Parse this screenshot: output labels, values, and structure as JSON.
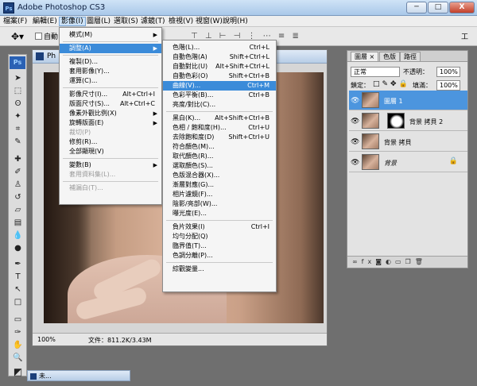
{
  "app": {
    "title": "Adobe Photoshop CS3",
    "icon": "Ps",
    "window_controls": {
      "minimize": "─",
      "maximize": "□",
      "close": "X"
    }
  },
  "menubar": [
    "檔案(F)",
    "編輯(E)",
    "影像(I)",
    "圖層(L)",
    "選取(S)",
    "濾鏡(T)",
    "檢視(V)",
    "視窗(W)",
    "說明(H)"
  ],
  "options_bar": {
    "auto_select_label": "自動",
    "workspace_label": "工"
  },
  "image_menu": {
    "items": [
      {
        "label": "模式(M)",
        "submenu": true
      },
      {
        "sep": true
      },
      {
        "label": "調整(A)",
        "submenu": true,
        "highlighted": true
      },
      {
        "sep": true
      },
      {
        "label": "複製(D)..."
      },
      {
        "label": "套用影像(Y)..."
      },
      {
        "label": "運算(C)..."
      },
      {
        "sep": true
      },
      {
        "label": "影像尺寸(I)...",
        "shortcut": "Alt+Ctrl+I"
      },
      {
        "label": "版面尺寸(S)...",
        "shortcut": "Alt+Ctrl+C"
      },
      {
        "label": "像素外觀比例(X)",
        "submenu": true
      },
      {
        "label": "旋轉版面(E)",
        "submenu": true
      },
      {
        "label": "裁切(P)",
        "disabled": true
      },
      {
        "label": "修剪(R)..."
      },
      {
        "label": "全部顯現(V)"
      },
      {
        "sep": true
      },
      {
        "label": "變數(B)",
        "submenu": true
      },
      {
        "label": "套用資料集(L)...",
        "disabled": true
      },
      {
        "sep": true
      },
      {
        "label": "補漏白(T)...",
        "disabled": true
      }
    ]
  },
  "adjust_menu": {
    "items": [
      {
        "label": "色階(L)...",
        "shortcut": "Ctrl+L"
      },
      {
        "label": "自動色階(A)",
        "shortcut": "Shift+Ctrl+L"
      },
      {
        "label": "自動對比(U)",
        "shortcut": "Alt+Shift+Ctrl+L"
      },
      {
        "label": "自動色彩(O)",
        "shortcut": "Shift+Ctrl+B"
      },
      {
        "label": "曲線(V)...",
        "shortcut": "Ctrl+M",
        "highlighted": true
      },
      {
        "label": "色彩平衡(B)...",
        "shortcut": "Ctrl+B"
      },
      {
        "label": "亮度/對比(C)..."
      },
      {
        "sep": true
      },
      {
        "label": "黑白(K)...",
        "shortcut": "Alt+Shift+Ctrl+B"
      },
      {
        "label": "色相 / 飽和度(H)...",
        "shortcut": "Ctrl+U"
      },
      {
        "label": "去除飽和度(D)",
        "shortcut": "Shift+Ctrl+U"
      },
      {
        "label": "符合顏色(M)..."
      },
      {
        "label": "取代顏色(R)..."
      },
      {
        "label": "選取顏色(S)..."
      },
      {
        "label": "色版混合器(X)..."
      },
      {
        "label": "漸層對應(G)..."
      },
      {
        "label": "相片濾鏡(F)..."
      },
      {
        "label": "陰影/亮部(W)..."
      },
      {
        "label": "曝光度(E)..."
      },
      {
        "sep": true
      },
      {
        "label": "負片效果(I)",
        "shortcut": "Ctrl+I"
      },
      {
        "label": "均勻分配(Q)"
      },
      {
        "label": "臨界值(T)..."
      },
      {
        "label": "色調分離(P)..."
      },
      {
        "sep": true
      },
      {
        "label": "綜觀變量..."
      }
    ]
  },
  "document": {
    "title": "Ph",
    "zoom": "100%",
    "doc_info": "文件：811.2K/3.43M"
  },
  "layers_panel": {
    "tabs": [
      "圖層 ×",
      "色版",
      "路徑"
    ],
    "blend_mode": "正常",
    "opacity_label": "不透明：",
    "opacity_value": "100%",
    "lock_label": "鎖定：",
    "fill_label": "填滿：",
    "fill_value": "100%",
    "layers": [
      {
        "name": "圖層 1",
        "selected": true,
        "mask": false
      },
      {
        "name": "背景 拷貝 2",
        "selected": false,
        "mask": true
      },
      {
        "name": "背景 拷貝",
        "selected": false,
        "mask": false
      },
      {
        "name": "背景",
        "selected": false,
        "mask": false,
        "locked": true
      }
    ]
  },
  "minimized_doc": {
    "title": "未..."
  }
}
